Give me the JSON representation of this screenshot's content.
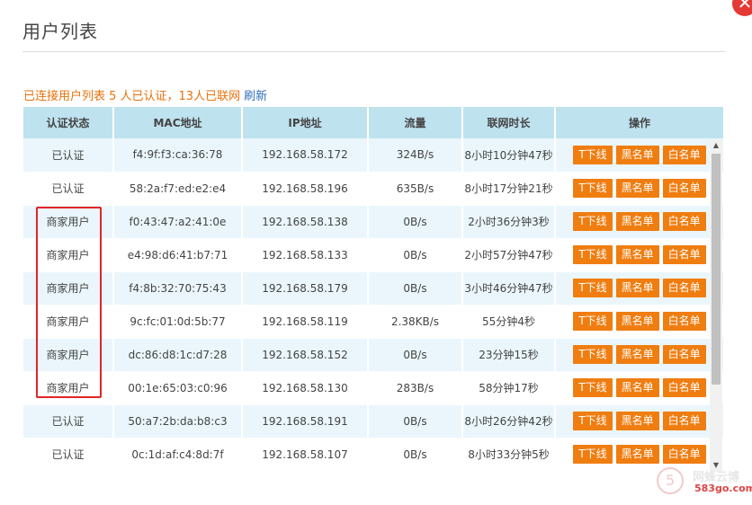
{
  "dialog": {
    "title": "用户列表",
    "close_glyph": "✕"
  },
  "summary": {
    "text": "已连接用户列表 5 人已认证，13人已联网",
    "refresh_label": "刷新"
  },
  "table": {
    "headers": [
      "认证状态",
      "MAC地址",
      "IP地址",
      "流量",
      "联网时长",
      "操作"
    ],
    "actions": [
      "T下线",
      "黑名单",
      "白名单"
    ],
    "rows": [
      {
        "status": "已认证",
        "mac": "f4:9f:f3:ca:36:78",
        "ip": "192.168.58.172",
        "flow": "324B/s",
        "duration": "8小时10分钟47秒"
      },
      {
        "status": "已认证",
        "mac": "58:2a:f7:ed:e2:e4",
        "ip": "192.168.58.196",
        "flow": "635B/s",
        "duration": "8小时17分钟21秒"
      },
      {
        "status": "商家用户",
        "mac": "f0:43:47:a2:41:0e",
        "ip": "192.168.58.138",
        "flow": "0B/s",
        "duration": "2小时36分钟3秒"
      },
      {
        "status": "商家用户",
        "mac": "e4:98:d6:41:b7:71",
        "ip": "192.168.58.133",
        "flow": "0B/s",
        "duration": "2小时57分钟47秒"
      },
      {
        "status": "商家用户",
        "mac": "f4:8b:32:70:75:43",
        "ip": "192.168.58.179",
        "flow": "0B/s",
        "duration": "3小时46分钟47秒"
      },
      {
        "status": "商家用户",
        "mac": "9c:fc:01:0d:5b:77",
        "ip": "192.168.58.119",
        "flow": "2.38KB/s",
        "duration": "55分钟4秒"
      },
      {
        "status": "商家用户",
        "mac": "dc:86:d8:1c:d7:28",
        "ip": "192.168.58.152",
        "flow": "0B/s",
        "duration": "23分钟15秒"
      },
      {
        "status": "商家用户",
        "mac": "00:1e:65:03:c0:96",
        "ip": "192.168.58.130",
        "flow": "283B/s",
        "duration": "58分钟17秒"
      },
      {
        "status": "已认证",
        "mac": "50:a7:2b:da:b8:c3",
        "ip": "192.168.58.191",
        "flow": "0B/s",
        "duration": "8小时26分钟42秒"
      },
      {
        "status": "已认证",
        "mac": "0c:1d:af:c4:8d:7f",
        "ip": "192.168.58.107",
        "flow": "0B/s",
        "duration": "8小时33分钟5秒"
      }
    ]
  },
  "watermark": {
    "name": "网蜂云博",
    "url": "583go.com",
    "mark": "5"
  },
  "colors": {
    "accent_orange": "#f07d10",
    "header_blue": "#bfe2ef",
    "highlight_red": "#e0242a",
    "link_blue": "#2f6fb8"
  }
}
